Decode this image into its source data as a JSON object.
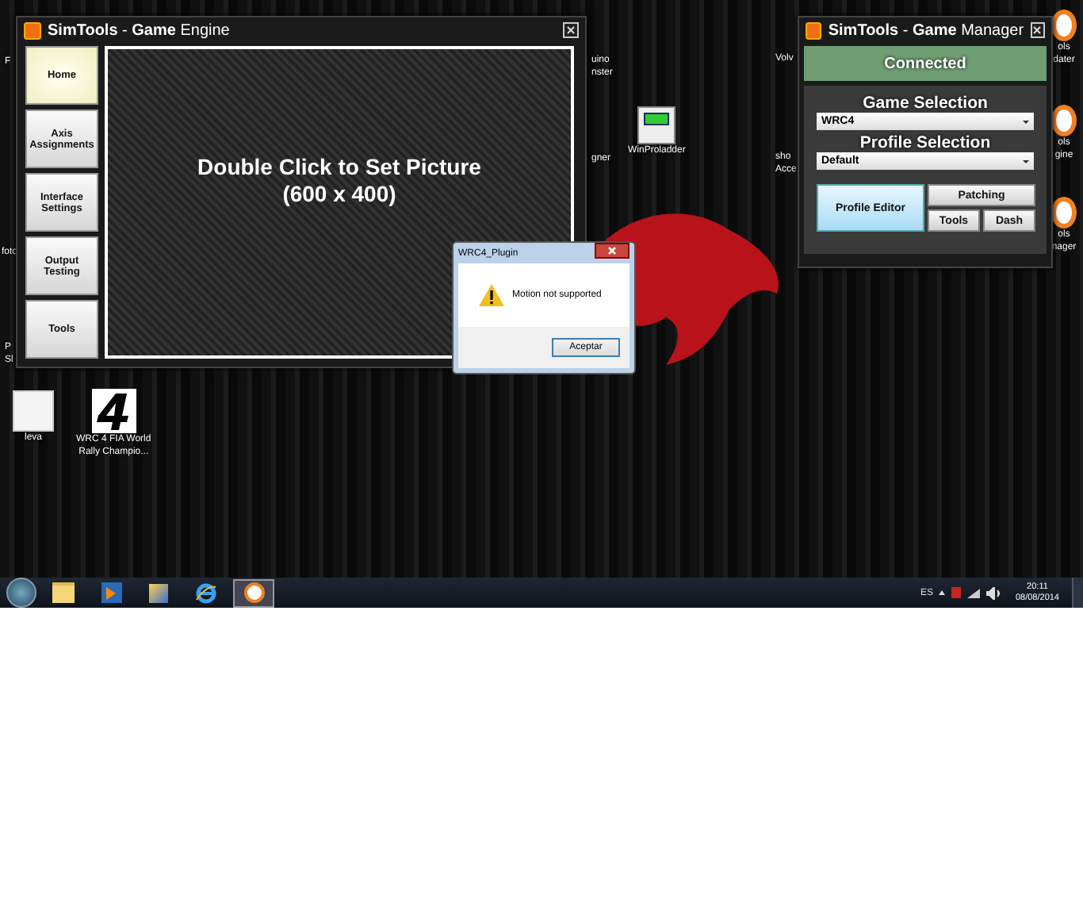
{
  "desktop_icons": [
    {
      "kind": "covered",
      "lines": [
        "F"
      ]
    },
    {
      "kind": "covered",
      "lines": [
        "foto"
      ]
    },
    {
      "kind": "covered",
      "lines": [
        "P",
        "Sl"
      ]
    },
    {
      "kind": "covered",
      "lines": [
        "uino",
        "nster"
      ]
    },
    {
      "kind": "covered",
      "lines": [
        "gner"
      ]
    },
    {
      "kind": "program",
      "lines": [
        "WinProladder"
      ]
    },
    {
      "kind": "covered",
      "lines": [
        "Volv"
      ]
    },
    {
      "kind": "covered",
      "lines": [
        "sho",
        "Acce"
      ]
    },
    {
      "kind": "simtools",
      "lines": [
        "ols",
        "dater"
      ]
    },
    {
      "kind": "simtools",
      "lines": [
        "ols",
        "gine"
      ]
    },
    {
      "kind": "simtools",
      "lines": [
        "ols",
        "nager"
      ]
    },
    {
      "kind": "blank",
      "lines": [
        "leva"
      ]
    },
    {
      "kind": "number",
      "lines": [
        "WRC 4 FIA World",
        "Rally Champio..."
      ]
    }
  ],
  "game_engine": {
    "title": "**SimTools** - **Game** Engine",
    "nav": [
      {
        "label": "Home",
        "selected": true
      },
      {
        "label": "Axis Assignments",
        "selected": false
      },
      {
        "label": "Interface Settings",
        "selected": false
      },
      {
        "label": "Output Testing",
        "selected": false
      },
      {
        "label": "Tools",
        "selected": false
      }
    ],
    "picture_prompt": [
      "Double Click to Set Picture",
      "(600 x 400)"
    ]
  },
  "game_manager": {
    "title": "**SimTools** - **Game** Manager",
    "status": "Connected",
    "game_selection": {
      "label": "Game Selection",
      "value": "WRC4"
    },
    "profile_selection": {
      "label": "Profile Selection",
      "value": "Default"
    },
    "buttons": [
      {
        "label": "Profile Editor",
        "selected": true
      },
      {
        "label": "Patching",
        "selected": false
      },
      {
        "label": "Tools",
        "selected": false
      },
      {
        "label": "Dash",
        "selected": false
      }
    ]
  },
  "dialog": {
    "title": "WRC4_Plugin",
    "message": "Motion not supported",
    "button": "Aceptar"
  },
  "taskbar": {
    "apps": [
      {
        "kind": "folder",
        "active": false
      },
      {
        "kind": "media",
        "active": false
      },
      {
        "kind": "tool",
        "active": false
      },
      {
        "kind": "browser",
        "active": false
      },
      {
        "kind": "simtools",
        "active": true
      }
    ],
    "language": "ES",
    "time": "20:11",
    "date": "08/08/2014"
  }
}
